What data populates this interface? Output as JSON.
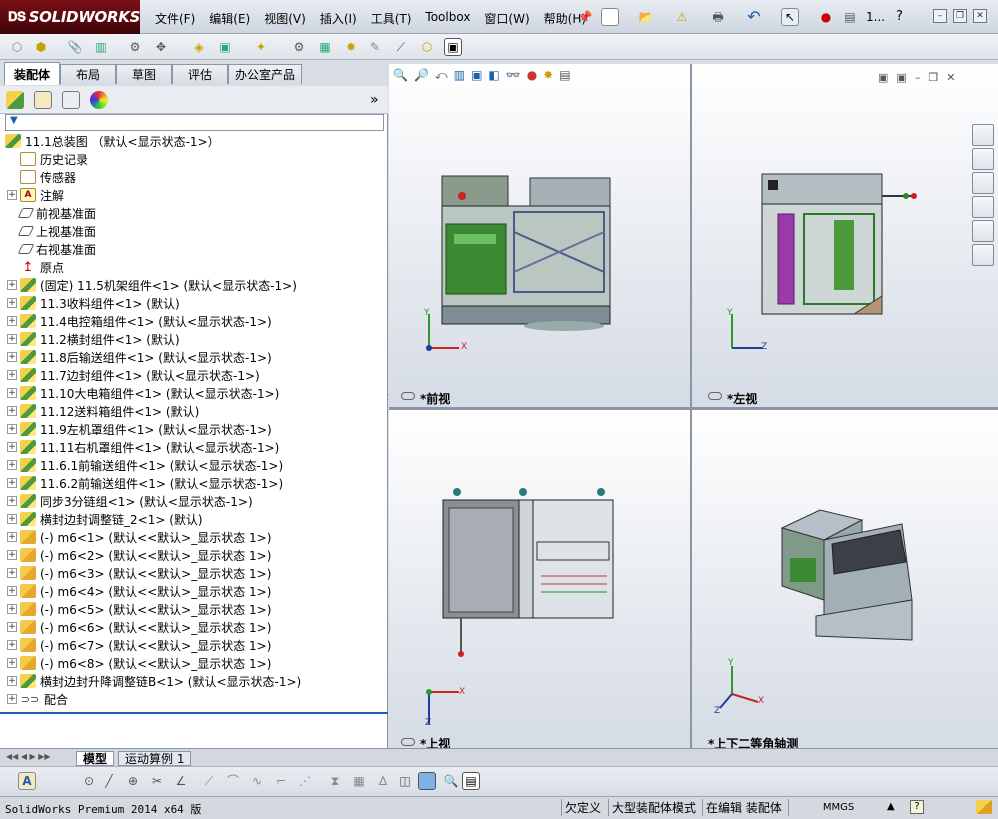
{
  "app": {
    "brand": "SOLIDWORKS",
    "menus": [
      "文件(F)",
      "编辑(E)",
      "视图(V)",
      "插入(I)",
      "工具(T)",
      "Toolbox",
      "窗口(W)",
      "帮助(H)"
    ],
    "title_short": "1...",
    "help": "?"
  },
  "left_tabs": [
    "装配体",
    "布局",
    "草图",
    "评估",
    "办公室产品"
  ],
  "panel": {
    "expand_label": "»",
    "filter_label": "▼"
  },
  "tree": [
    {
      "label": "11.1总装图 （默认<显示状态-1>）",
      "icon": "asm",
      "exp": false
    },
    {
      "label": "历史记录",
      "icon": "hist",
      "exp": false
    },
    {
      "label": "传感器",
      "icon": "hist",
      "exp": false
    },
    {
      "label": "注解",
      "icon": "ann",
      "exp": true
    },
    {
      "label": "前视基准面",
      "icon": "plane",
      "exp": false
    },
    {
      "label": "上视基准面",
      "icon": "plane",
      "exp": false
    },
    {
      "label": "右视基准面",
      "icon": "plane",
      "exp": false
    },
    {
      "label": "原点",
      "icon": "orig",
      "exp": false
    },
    {
      "label": "(固定) 11.5机架组件<1> (默认<显示状态-1>)",
      "icon": "asm",
      "exp": true
    },
    {
      "label": "11.3收料组件<1> (默认)",
      "icon": "asm",
      "exp": true
    },
    {
      "label": "11.4电控箱组件<1> (默认<显示状态-1>)",
      "icon": "asm",
      "exp": true
    },
    {
      "label": "11.2横封组件<1> (默认)",
      "icon": "asm",
      "exp": true
    },
    {
      "label": "11.8后输送组件<1> (默认<显示状态-1>)",
      "icon": "asm",
      "exp": true
    },
    {
      "label": "11.7边封组件<1> (默认<显示状态-1>)",
      "icon": "asm",
      "exp": true
    },
    {
      "label": "11.10大电箱组件<1> (默认<显示状态-1>)",
      "icon": "asm",
      "exp": true
    },
    {
      "label": "11.12送料箱组件<1> (默认)",
      "icon": "asm",
      "exp": true
    },
    {
      "label": "11.9左机罩组件<1> (默认<显示状态-1>)",
      "icon": "asm",
      "exp": true
    },
    {
      "label": "11.11右机罩组件<1> (默认<显示状态-1>)",
      "icon": "asm",
      "exp": true
    },
    {
      "label": "11.6.1前输送组件<1> (默认<显示状态-1>)",
      "icon": "asm",
      "exp": true
    },
    {
      "label": "11.6.2前输送组件<1> (默认<显示状态-1>)",
      "icon": "asm",
      "exp": true
    },
    {
      "label": "同步3分链组<1> (默认<显示状态-1>)",
      "icon": "asm",
      "exp": true
    },
    {
      "label": "横封边封调整链_2<1> (默认)",
      "icon": "asm",
      "exp": true
    },
    {
      "label": "(-) m6<1> (默认<<默认>_显示状态 1>)",
      "icon": "part",
      "exp": true
    },
    {
      "label": "(-) m6<2> (默认<<默认>_显示状态 1>)",
      "icon": "part",
      "exp": true
    },
    {
      "label": "(-) m6<3> (默认<<默认>_显示状态 1>)",
      "icon": "part",
      "exp": true
    },
    {
      "label": "(-) m6<4> (默认<<默认>_显示状态 1>)",
      "icon": "part",
      "exp": true
    },
    {
      "label": "(-) m6<5> (默认<<默认>_显示状态 1>)",
      "icon": "part",
      "exp": true
    },
    {
      "label": "(-) m6<6> (默认<<默认>_显示状态 1>)",
      "icon": "part",
      "exp": true
    },
    {
      "label": "(-) m6<7> (默认<<默认>_显示状态 1>)",
      "icon": "part",
      "exp": true
    },
    {
      "label": "(-) m6<8> (默认<<默认>_显示状态 1>)",
      "icon": "part",
      "exp": true
    },
    {
      "label": "横封边封升降调整链B<1> (默认<显示状态-1>)",
      "icon": "asm",
      "exp": true
    },
    {
      "label": "配合",
      "icon": "mate",
      "exp": true
    }
  ],
  "viewports": {
    "front": "*前视",
    "left": "*左视",
    "top": "*上视",
    "iso": "*上下二等角轴测"
  },
  "axes": {
    "x": "X",
    "y": "Y",
    "z": "Z"
  },
  "bottom_tabs": [
    "模型",
    "运动算例 1"
  ],
  "status": {
    "version": "SolidWorks Premium 2014 x64 版",
    "under_defined": "欠定义",
    "large_mode": "大型装配体模式",
    "editing": "在编辑 装配体",
    "units": "MMGS",
    "up": "▲",
    "help": "?"
  }
}
